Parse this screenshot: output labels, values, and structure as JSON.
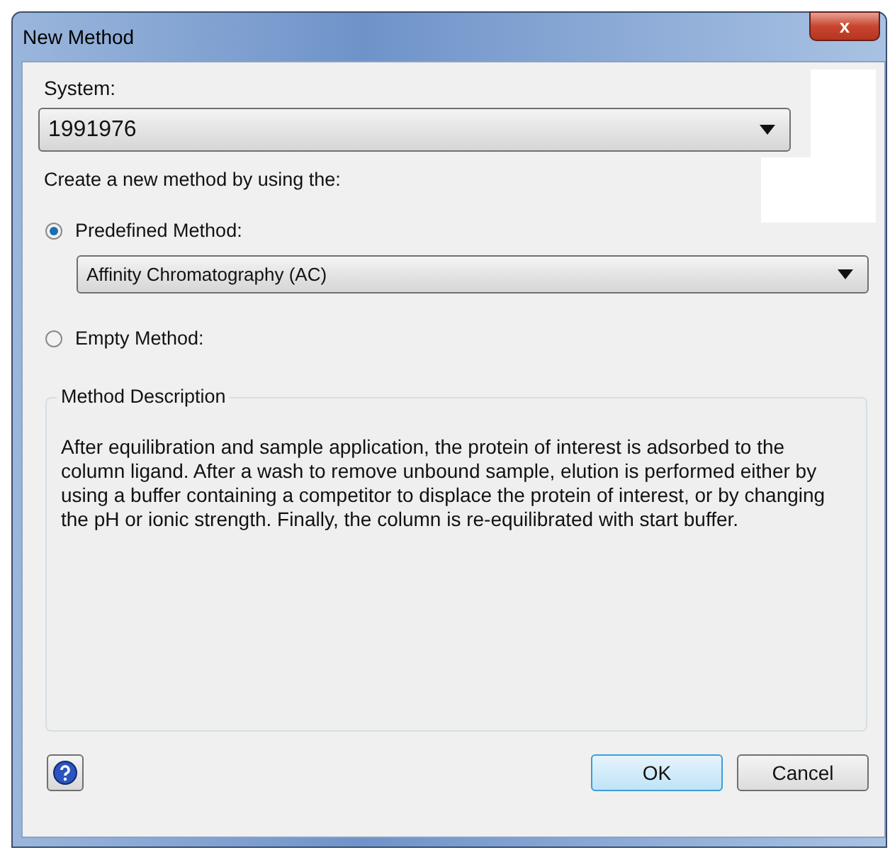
{
  "window": {
    "title": "New Method",
    "close_label": "x"
  },
  "system": {
    "label": "System:",
    "value": "1991976"
  },
  "prompt": "Create a new method by using the:",
  "options": [
    {
      "kind": "predefined",
      "label": "Predefined Method:",
      "selected": true,
      "value": "Affinity Chromatography (AC)"
    },
    {
      "kind": "empty",
      "label": "Empty Method:",
      "selected": false
    }
  ],
  "description": {
    "title": "Method Description",
    "text": "After equilibration and sample application, the protein of interest is adsorbed to the column ligand. After a wash to remove unbound sample, elution is performed either by using a buffer containing a competitor to displace the protein of interest, or by changing the pH or ionic strength. Finally, the column is re-equilibrated with start buffer."
  },
  "buttons": [
    {
      "label": "OK",
      "default": true
    },
    {
      "label": "Cancel",
      "default": false
    }
  ]
}
